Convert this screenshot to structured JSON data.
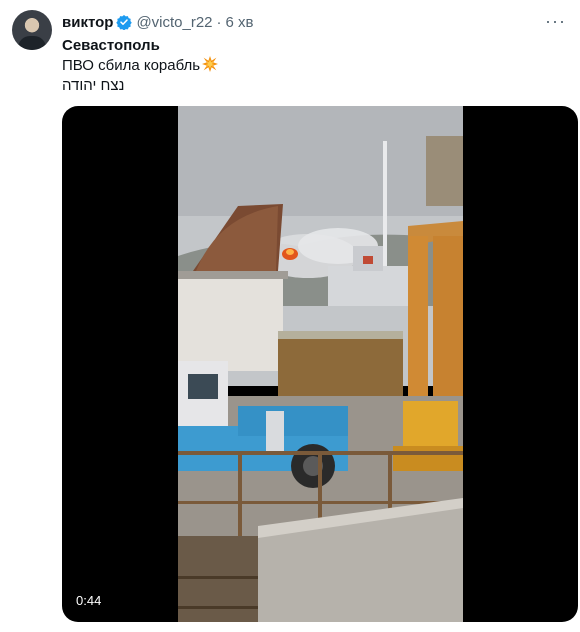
{
  "user": {
    "name": "виктор",
    "handle": "@victo_r22",
    "separator": "·",
    "time": "6 хв"
  },
  "tweet": {
    "line1": "Севастополь",
    "line2": "ПВО сбила корабль",
    "line3": "נצח יהודה"
  },
  "video": {
    "duration": "0:44"
  },
  "colors": {
    "verified": "#1d9bf0",
    "secondary_text": "#536471"
  }
}
